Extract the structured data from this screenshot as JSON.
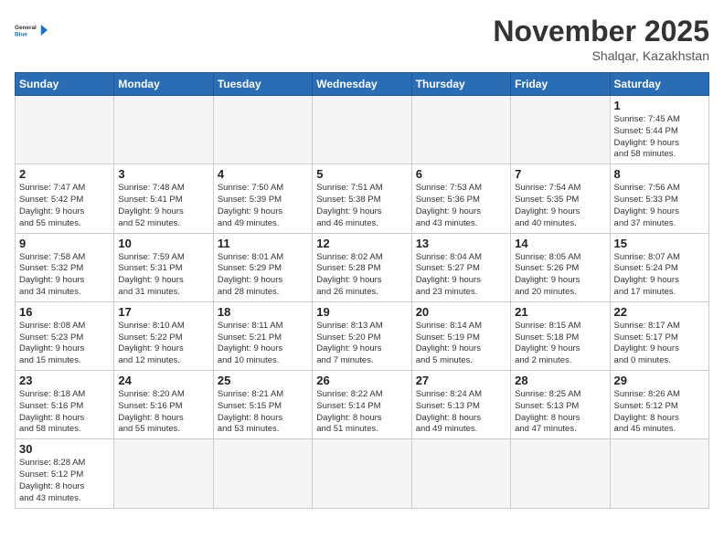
{
  "logo": {
    "general": "General",
    "blue": "Blue"
  },
  "header": {
    "month": "November 2025",
    "location": "Shalqar, Kazakhstan"
  },
  "weekdays": [
    "Sunday",
    "Monday",
    "Tuesday",
    "Wednesday",
    "Thursday",
    "Friday",
    "Saturday"
  ],
  "weeks": [
    [
      {
        "day": "",
        "info": ""
      },
      {
        "day": "",
        "info": ""
      },
      {
        "day": "",
        "info": ""
      },
      {
        "day": "",
        "info": ""
      },
      {
        "day": "",
        "info": ""
      },
      {
        "day": "",
        "info": ""
      },
      {
        "day": "1",
        "info": "Sunrise: 7:45 AM\nSunset: 5:44 PM\nDaylight: 9 hours\nand 58 minutes."
      }
    ],
    [
      {
        "day": "2",
        "info": "Sunrise: 7:47 AM\nSunset: 5:42 PM\nDaylight: 9 hours\nand 55 minutes."
      },
      {
        "day": "3",
        "info": "Sunrise: 7:48 AM\nSunset: 5:41 PM\nDaylight: 9 hours\nand 52 minutes."
      },
      {
        "day": "4",
        "info": "Sunrise: 7:50 AM\nSunset: 5:39 PM\nDaylight: 9 hours\nand 49 minutes."
      },
      {
        "day": "5",
        "info": "Sunrise: 7:51 AM\nSunset: 5:38 PM\nDaylight: 9 hours\nand 46 minutes."
      },
      {
        "day": "6",
        "info": "Sunrise: 7:53 AM\nSunset: 5:36 PM\nDaylight: 9 hours\nand 43 minutes."
      },
      {
        "day": "7",
        "info": "Sunrise: 7:54 AM\nSunset: 5:35 PM\nDaylight: 9 hours\nand 40 minutes."
      },
      {
        "day": "8",
        "info": "Sunrise: 7:56 AM\nSunset: 5:33 PM\nDaylight: 9 hours\nand 37 minutes."
      }
    ],
    [
      {
        "day": "9",
        "info": "Sunrise: 7:58 AM\nSunset: 5:32 PM\nDaylight: 9 hours\nand 34 minutes."
      },
      {
        "day": "10",
        "info": "Sunrise: 7:59 AM\nSunset: 5:31 PM\nDaylight: 9 hours\nand 31 minutes."
      },
      {
        "day": "11",
        "info": "Sunrise: 8:01 AM\nSunset: 5:29 PM\nDaylight: 9 hours\nand 28 minutes."
      },
      {
        "day": "12",
        "info": "Sunrise: 8:02 AM\nSunset: 5:28 PM\nDaylight: 9 hours\nand 26 minutes."
      },
      {
        "day": "13",
        "info": "Sunrise: 8:04 AM\nSunset: 5:27 PM\nDaylight: 9 hours\nand 23 minutes."
      },
      {
        "day": "14",
        "info": "Sunrise: 8:05 AM\nSunset: 5:26 PM\nDaylight: 9 hours\nand 20 minutes."
      },
      {
        "day": "15",
        "info": "Sunrise: 8:07 AM\nSunset: 5:24 PM\nDaylight: 9 hours\nand 17 minutes."
      }
    ],
    [
      {
        "day": "16",
        "info": "Sunrise: 8:08 AM\nSunset: 5:23 PM\nDaylight: 9 hours\nand 15 minutes."
      },
      {
        "day": "17",
        "info": "Sunrise: 8:10 AM\nSunset: 5:22 PM\nDaylight: 9 hours\nand 12 minutes."
      },
      {
        "day": "18",
        "info": "Sunrise: 8:11 AM\nSunset: 5:21 PM\nDaylight: 9 hours\nand 10 minutes."
      },
      {
        "day": "19",
        "info": "Sunrise: 8:13 AM\nSunset: 5:20 PM\nDaylight: 9 hours\nand 7 minutes."
      },
      {
        "day": "20",
        "info": "Sunrise: 8:14 AM\nSunset: 5:19 PM\nDaylight: 9 hours\nand 5 minutes."
      },
      {
        "day": "21",
        "info": "Sunrise: 8:15 AM\nSunset: 5:18 PM\nDaylight: 9 hours\nand 2 minutes."
      },
      {
        "day": "22",
        "info": "Sunrise: 8:17 AM\nSunset: 5:17 PM\nDaylight: 9 hours\nand 0 minutes."
      }
    ],
    [
      {
        "day": "23",
        "info": "Sunrise: 8:18 AM\nSunset: 5:16 PM\nDaylight: 8 hours\nand 58 minutes."
      },
      {
        "day": "24",
        "info": "Sunrise: 8:20 AM\nSunset: 5:16 PM\nDaylight: 8 hours\nand 55 minutes."
      },
      {
        "day": "25",
        "info": "Sunrise: 8:21 AM\nSunset: 5:15 PM\nDaylight: 8 hours\nand 53 minutes."
      },
      {
        "day": "26",
        "info": "Sunrise: 8:22 AM\nSunset: 5:14 PM\nDaylight: 8 hours\nand 51 minutes."
      },
      {
        "day": "27",
        "info": "Sunrise: 8:24 AM\nSunset: 5:13 PM\nDaylight: 8 hours\nand 49 minutes."
      },
      {
        "day": "28",
        "info": "Sunrise: 8:25 AM\nSunset: 5:13 PM\nDaylight: 8 hours\nand 47 minutes."
      },
      {
        "day": "29",
        "info": "Sunrise: 8:26 AM\nSunset: 5:12 PM\nDaylight: 8 hours\nand 45 minutes."
      }
    ],
    [
      {
        "day": "30",
        "info": "Sunrise: 8:28 AM\nSunset: 5:12 PM\nDaylight: 8 hours\nand 43 minutes."
      },
      {
        "day": "",
        "info": ""
      },
      {
        "day": "",
        "info": ""
      },
      {
        "day": "",
        "info": ""
      },
      {
        "day": "",
        "info": ""
      },
      {
        "day": "",
        "info": ""
      },
      {
        "day": "",
        "info": ""
      }
    ]
  ]
}
